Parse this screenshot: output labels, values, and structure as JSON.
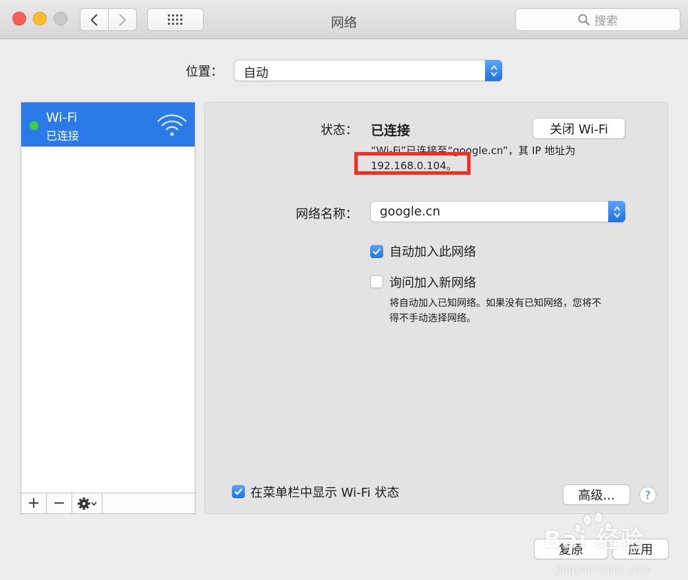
{
  "window": {
    "title": "网络",
    "search_placeholder": "搜索"
  },
  "location": {
    "label": "位置：",
    "value": "自动"
  },
  "services": [
    {
      "name": "Wi-Fi",
      "status": "已连接",
      "status_color": "#3fce48",
      "selected": true
    }
  ],
  "sidebar_toolbar": {
    "add": "+",
    "remove": "−"
  },
  "detail": {
    "status_label": "状态：",
    "status_value": "已连接",
    "wifi_off_button": "关闭 Wi-Fi",
    "status_desc_line1": "“Wi-Fi”已连接至“google.cn”，其 IP 地址为",
    "status_desc_line2": "192.168.0.104。",
    "network_name_label": "网络名称：",
    "network_name_value": "google.cn",
    "auto_join_label": "自动加入此网络",
    "auto_join_checked": true,
    "ask_join_label": "询问加入新网络",
    "ask_join_checked": false,
    "ask_join_desc_line1": "将自动加入已知网络。如果没有已知网络，您将不",
    "ask_join_desc_line2": "得不手动选择网络。",
    "show_in_menubar_label": "在菜单栏中显示 Wi-Fi 状态",
    "show_in_menubar_checked": true,
    "advanced_button": "高级...",
    "help_button": "?"
  },
  "footer": {
    "revert_button": "复原",
    "apply_button": "应用"
  },
  "watermark": {
    "text": "Bai 经验",
    "sub": "jingyan.baidu.com"
  },
  "colors": {
    "accent": "#2a7be7",
    "highlight_box": "#ff2a1e"
  }
}
